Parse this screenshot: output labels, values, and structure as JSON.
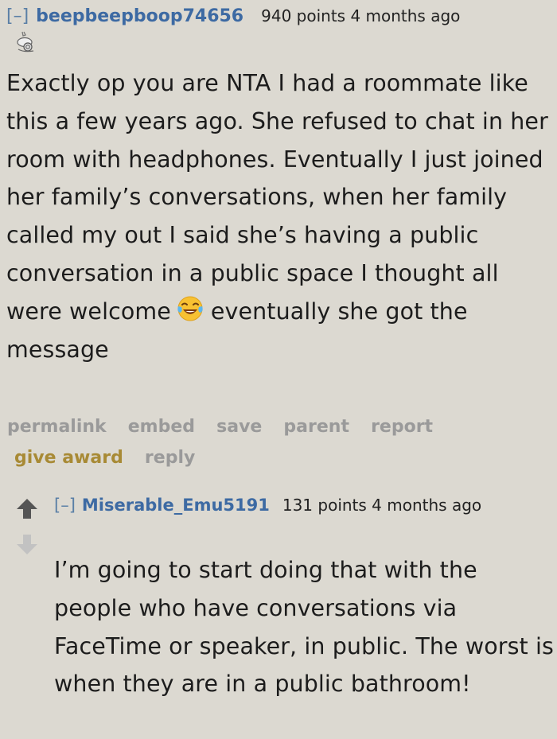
{
  "comment": {
    "collapse": "[–]",
    "author": "beepbeepboop74656",
    "score_time": "940 points 4 months ago",
    "flair_icon": "snail-flair-icon",
    "body_before_emoji": "Exactly op you are NTA I had a roommate like this a few years ago. She refused to chat in her room with headphones. Eventually I just joined her family’s conversations, when her family called my out I said she’s having a public conversation in a public space I thought all were welcome",
    "emoji": "face-with-tears-of-joy-emoji",
    "body_after_emoji": "eventually she got the message",
    "actions": {
      "permalink": "permalink",
      "embed": "embed",
      "save": "save",
      "parent": "parent",
      "report": "report",
      "give_award": "give award",
      "reply": "reply"
    }
  },
  "reply": {
    "collapse": "[–]",
    "author": "Miserable_Emu5191",
    "score_time": "131 points 4 months ago",
    "body": "I’m going to start doing that with the people who have conversations via FaceTime or speaker, in public. The worst is when they are in a public bathroom!"
  },
  "colors": {
    "background": "#dcd9d1",
    "author_link": "#3d6aa3",
    "action_text": "#9a9a9a",
    "award_text": "#a88a35"
  }
}
